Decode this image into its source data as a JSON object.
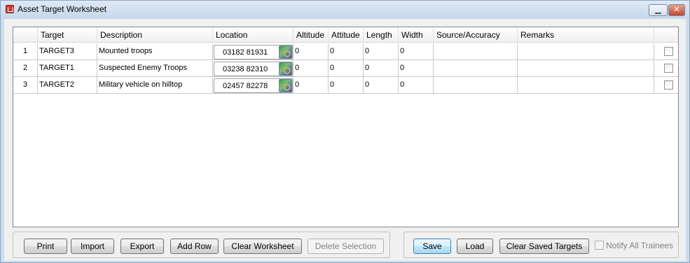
{
  "window": {
    "title": "Asset Target Worksheet",
    "minimize_label": "▁",
    "close_label": "✕"
  },
  "grid": {
    "columns": [
      "",
      "Target",
      "Description",
      "Location",
      "Altitude",
      "Attitude",
      "Length",
      "Width",
      "Source/Accuracy",
      "Remarks",
      ""
    ],
    "rows": [
      {
        "num": "1",
        "target": "TARGET3",
        "description": "Mounted troops",
        "location": "03182 81931",
        "altitude": "0",
        "attitude": "0",
        "length": "0",
        "width": "0",
        "source": "",
        "remarks": "",
        "checked": false
      },
      {
        "num": "2",
        "target": "TARGET1",
        "description": "Suspected Enemy Troops",
        "location": "03238 82310",
        "altitude": "0",
        "attitude": "0",
        "length": "0",
        "width": "0",
        "source": "",
        "remarks": "",
        "checked": false
      },
      {
        "num": "3",
        "target": "TARGET2",
        "description": "Military vehicle on hilltop",
        "location": "02457 82278",
        "altitude": "0",
        "attitude": "0",
        "length": "0",
        "width": "0",
        "source": "",
        "remarks": "",
        "checked": false
      }
    ]
  },
  "buttons": {
    "print": "Print",
    "import": "Import",
    "export": "Export",
    "add_row": "Add Row",
    "clear_worksheet": "Clear Worksheet",
    "delete_selection": "Delete Selection",
    "save": "Save",
    "load": "Load",
    "clear_saved_targets": "Clear Saved Targets",
    "notify_all_trainees": "Notify All Trainees"
  },
  "icons": {
    "app": "app-icon",
    "map_picker": "map-picker-icon"
  }
}
